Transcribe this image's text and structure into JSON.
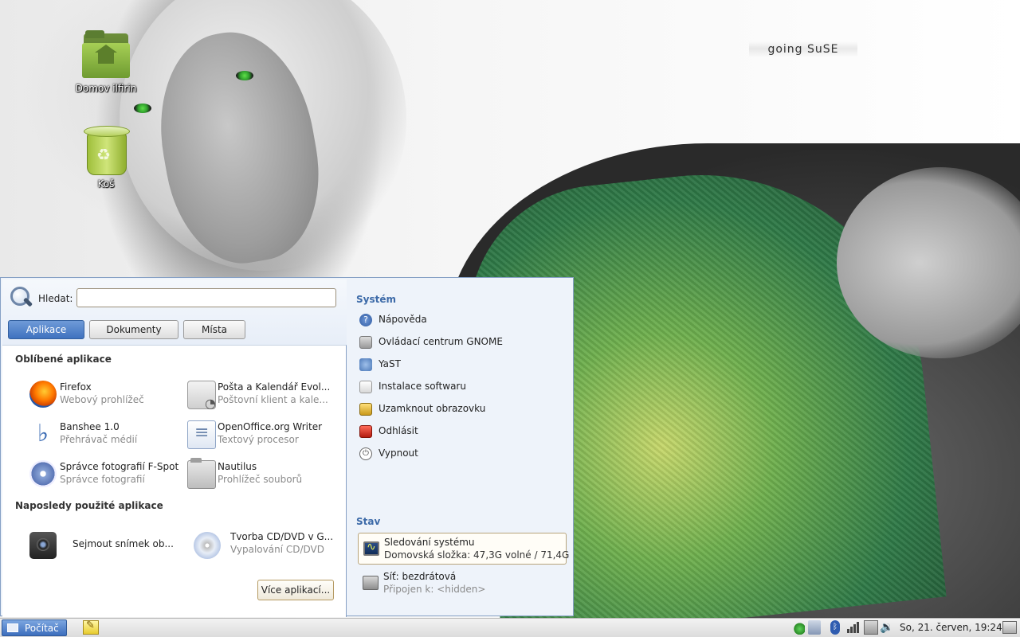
{
  "desktop": {
    "brand_text": "going SuSE",
    "icons": [
      {
        "label": "Domov ilfirin",
        "icon": "home-folder-icon"
      },
      {
        "label": "Koš",
        "icon": "trash-icon"
      }
    ]
  },
  "menu": {
    "search": {
      "label": "Hledat:",
      "value": "",
      "placeholder": ""
    },
    "tabs": [
      {
        "label": "Aplikace",
        "active": true
      },
      {
        "label": "Dokumenty",
        "active": false
      },
      {
        "label": "Místa",
        "active": false
      }
    ],
    "favorites_title": "Oblíbené aplikace",
    "favorites": [
      {
        "name": "Firefox",
        "desc": "Webový prohlížeč",
        "icon": "firefox-icon"
      },
      {
        "name": "Pošta a Kalendář Evol...",
        "desc": "Poštovní klient a kale...",
        "icon": "evolution-mail-icon"
      },
      {
        "name": "Banshee 1.0",
        "desc": "Přehrávač médií",
        "icon": "banshee-icon"
      },
      {
        "name": "OpenOffice.org Writer",
        "desc": "Textový procesor",
        "icon": "writer-icon"
      },
      {
        "name": "Správce fotografií F-Spot",
        "desc": "Správce fotografií",
        "icon": "f-spot-icon"
      },
      {
        "name": "Nautilus",
        "desc": "Prohlížeč souborů",
        "icon": "nautilus-icon"
      }
    ],
    "recent_title": "Naposledy použité aplikace",
    "recent": [
      {
        "name": "Sejmout snímek ob...",
        "desc": "",
        "icon": "camera-icon"
      },
      {
        "name": "Tvorba CD/DVD v G...",
        "desc": "Vypalování CD/DVD",
        "icon": "cd-burner-icon"
      }
    ],
    "more_apps_label": "Více aplikací...",
    "system_title": "Systém",
    "system_items": [
      {
        "label": "Nápověda",
        "icon": "help-icon"
      },
      {
        "label": "Ovládací centrum GNOME",
        "icon": "control-center-icon"
      },
      {
        "label": "YaST",
        "icon": "yast-icon"
      },
      {
        "label": "Instalace softwaru",
        "icon": "install-software-icon"
      },
      {
        "label": "Uzamknout obrazovku",
        "icon": "lock-screen-icon"
      },
      {
        "label": "Odhlásit",
        "icon": "logout-icon"
      },
      {
        "label": "Vypnout",
        "icon": "shutdown-icon"
      }
    ],
    "status_title": "Stav",
    "status_items": [
      {
        "title": "Sledování systému",
        "detail": "Domovská složka: 47,3G volné / 71,4G",
        "icon": "system-monitor-icon"
      },
      {
        "title": "Síť: bezdrátová",
        "detail": "Připojen k: <hidden>",
        "icon": "network-icon"
      }
    ]
  },
  "panel": {
    "computer_label": "Počítač",
    "clock": "So, 21. červen, 19:24",
    "tray_icons": [
      "network-status-icon",
      "connection-icon",
      "bluetooth-icon",
      "signal-strength-icon",
      "battery-icon",
      "volume-icon",
      "show-desktop-icon"
    ]
  },
  "colors": {
    "accent": "#3f72bf",
    "menu_bg": "#eef3fa",
    "section_heading": "#3c6aa8"
  }
}
